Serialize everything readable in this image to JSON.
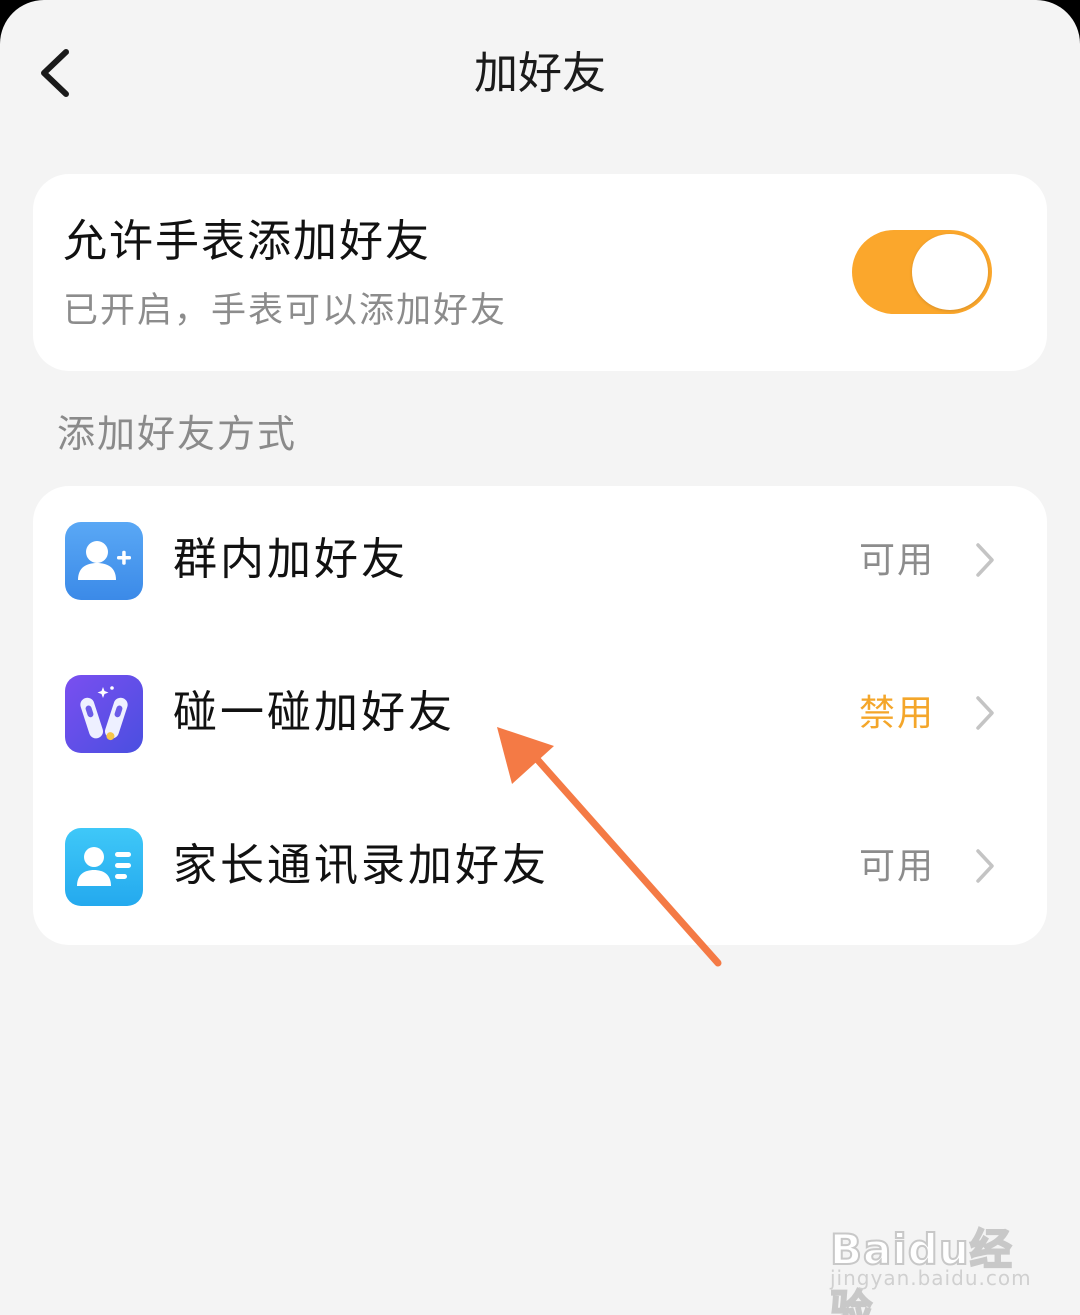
{
  "header": {
    "title": "加好友",
    "back_icon": "chevron-left-icon"
  },
  "watch_toggle": {
    "title": "允许手表添加好友",
    "subtitle": "已开启，手表可以添加好友",
    "enabled": true,
    "on_color": "#fba72c"
  },
  "methods_section": {
    "label": "添加好友方式",
    "items": [
      {
        "label": "群内加好友",
        "status": "可用",
        "icon": "group-add-user-icon",
        "status_state": "available"
      },
      {
        "label": "碰一碰加好友",
        "status": "禁用",
        "icon": "watch-bump-icon",
        "status_state": "disabled"
      },
      {
        "label": "家长通讯录加好友",
        "status": "可用",
        "icon": "contact-card-icon",
        "status_state": "available"
      }
    ]
  },
  "colors": {
    "background": "#f4f4f4",
    "card": "#ffffff",
    "accent_orange": "#fba72c",
    "disabled_text": "#f4a62a",
    "annotation_arrow": "#f47a45"
  },
  "watermark": {
    "brand": "Baidu经验",
    "url": "jingyan.baidu.com"
  }
}
